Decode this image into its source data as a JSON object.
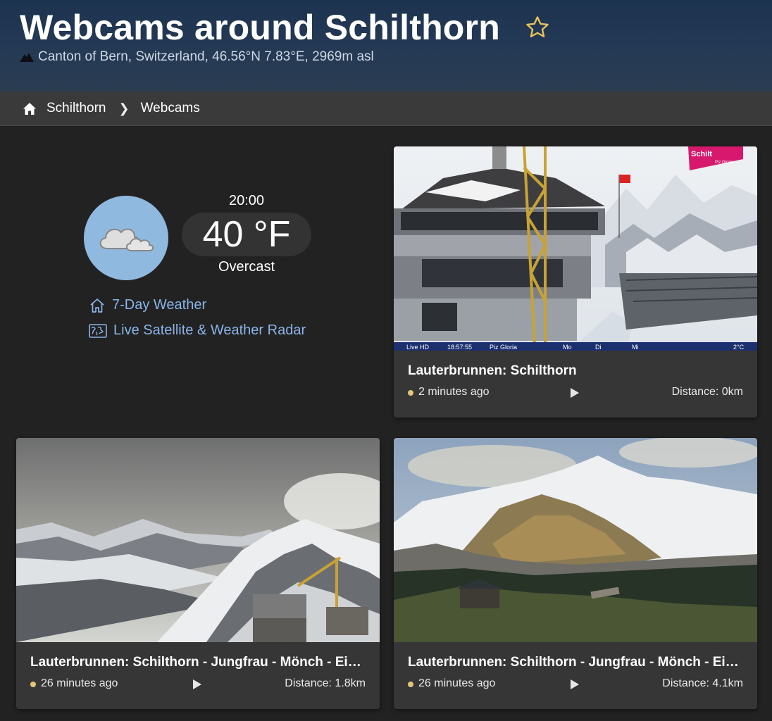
{
  "header": {
    "title": "Webcams around Schilthorn",
    "subtitle": "Canton of Bern, Switzerland, 46.56°N 7.83°E, 2969m asl"
  },
  "breadcrumb": {
    "home": "Schilthorn",
    "current": "Webcams"
  },
  "weather": {
    "time": "20:00",
    "temperature": "40 °F",
    "condition": "Overcast",
    "link_forecast": "7-Day Weather",
    "link_radar": "Live Satellite & Weather Radar"
  },
  "colors": {
    "link": "#8ab4e8",
    "status_dot": "#e2c77a",
    "page_bg": "#222222"
  },
  "webcams": [
    {
      "title": "Lauterbrunnen: Schilthorn",
      "updated": "2 minutes ago",
      "distance": "Distance: 0km",
      "overlay": {
        "live": "Live HD",
        "time": "18:57:55",
        "place": "Piz Gloria",
        "days": [
          "Mo",
          "Di",
          "Mi"
        ],
        "temp": "2°C",
        "logo": "Schilt",
        "logo_sub": "Piz Gloria"
      }
    },
    {
      "title": "Lauterbrunnen: Schilthorn - Jungfrau - Mönch - Eiger",
      "updated": "26 minutes ago",
      "distance": "Distance: 1.8km"
    },
    {
      "title": "Lauterbrunnen: Schilthorn - Jungfrau - Mönch - Eiger",
      "updated": "26 minutes ago",
      "distance": "Distance: 4.1km"
    }
  ]
}
